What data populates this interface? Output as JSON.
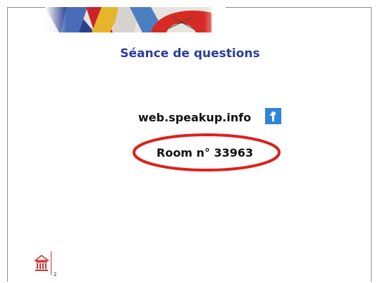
{
  "slide": {
    "title": "Séance de questions",
    "url": "web.speakup.info",
    "room": "Room n° 33963",
    "page_number": "2"
  },
  "colors": {
    "title": "#2b3d9c",
    "highlight_ellipse": "#e0201b",
    "speakup_icon": "#2f86d8",
    "logo": "#c9302c"
  },
  "icons": {
    "speakup": "speakup-logo-icon",
    "institution": "institution-building-icon"
  }
}
